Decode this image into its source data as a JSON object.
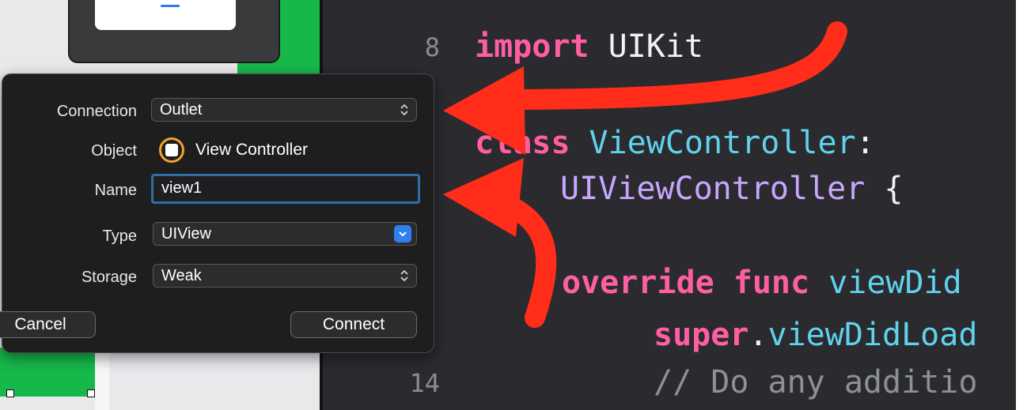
{
  "editor": {
    "line_numbers": [
      "8",
      "14"
    ],
    "lines": {
      "import_kw": "import",
      "import_mod": "UIKit",
      "class_kw": "class",
      "class_name": "ViewController",
      "colon": ":",
      "superclass": "UIViewController",
      "brace": "{",
      "override_kw": "override",
      "func_kw": "func",
      "func_name": "viewDid",
      "super_kw": "super",
      "super_dot": ".",
      "super_call": "viewDidLoad",
      "comment": "// Do any additio"
    }
  },
  "popover": {
    "connection": {
      "label": "Connection",
      "value": "Outlet"
    },
    "object": {
      "label": "Object",
      "value": "View Controller"
    },
    "name": {
      "label": "Name",
      "value": "view1"
    },
    "type": {
      "label": "Type",
      "value": "UIView"
    },
    "storage": {
      "label": "Storage",
      "value": "Weak"
    },
    "cancel_label": "Cancel",
    "connect_label": "Connect"
  },
  "icons": {
    "object": "view-controller-icon",
    "popup": "up-down-chevron-icon",
    "type_combo": "chevron-down-icon",
    "annotation": "red-arrow-icon"
  },
  "colors": {
    "keyword": "#ff5fa2",
    "type": "#5fd2ec",
    "accent": "#2f7ff0",
    "annotation_arrow": "#ff2d1a",
    "canvas_view": "#16b84a"
  }
}
